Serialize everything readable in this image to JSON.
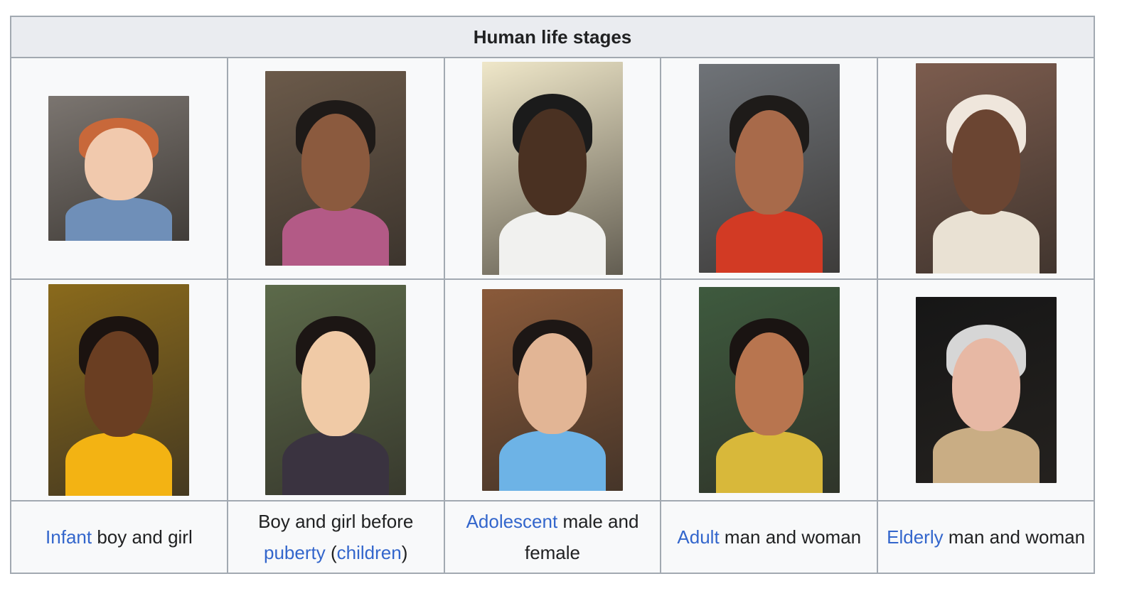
{
  "table": {
    "title": "Human life stages",
    "photos_row1": [
      {
        "name": "photo-infant-boy",
        "bg": "#7b7570",
        "skin": "#f1c9ad",
        "hair": "#c8683a",
        "cloth": "#6f8fb8"
      },
      {
        "name": "photo-boy-before-puberty",
        "bg": "#6b5a4a",
        "skin": "#8b5a3e",
        "hair": "#1e1a18",
        "cloth": "#b35a86"
      },
      {
        "name": "photo-adolescent-male",
        "bg": "#efe7c9",
        "skin": "#4a3122",
        "hair": "#1b1b1b",
        "cloth": "#f1f1ef"
      },
      {
        "name": "photo-adult-man",
        "bg": "#6f7378",
        "skin": "#a86a4a",
        "hair": "#1e1b19",
        "cloth": "#d23a24"
      },
      {
        "name": "photo-elderly-man",
        "bg": "#7c5c4e",
        "skin": "#6b4532",
        "hair": "#efe6dc",
        "cloth": "#e9e1d3"
      }
    ],
    "photos_row2": [
      {
        "name": "photo-infant-girl",
        "bg": "#8a6a1c",
        "skin": "#6a3e22",
        "hair": "#1b1310",
        "cloth": "#f3b313"
      },
      {
        "name": "photo-girl-before-puberty",
        "bg": "#5c6a4a",
        "skin": "#f0caa6",
        "hair": "#1c1614",
        "cloth": "#3a3340"
      },
      {
        "name": "photo-adolescent-female",
        "bg": "#8a5a3a",
        "skin": "#e2b595",
        "hair": "#1d1715",
        "cloth": "#6db3e6"
      },
      {
        "name": "photo-adult-woman",
        "bg": "#3e5a3e",
        "skin": "#b8754f",
        "hair": "#1a1412",
        "cloth": "#d8b83a"
      },
      {
        "name": "photo-elderly-woman",
        "bg": "#161616",
        "skin": "#e7b8a4",
        "hair": "#d6d6d6",
        "cloth": "#c9ad84"
      }
    ],
    "captions": [
      {
        "link": "Infant",
        "after": " boy and girl"
      },
      {
        "before": "Boy and girl before",
        "link": "puberty",
        "mid": " (",
        "link2": "children",
        "after": ")"
      },
      {
        "link": "Adolescent",
        "after": " male and female"
      },
      {
        "link": "Adult",
        "after": " man and woman"
      },
      {
        "link": "Elderly",
        "after": " man and woman"
      }
    ]
  }
}
